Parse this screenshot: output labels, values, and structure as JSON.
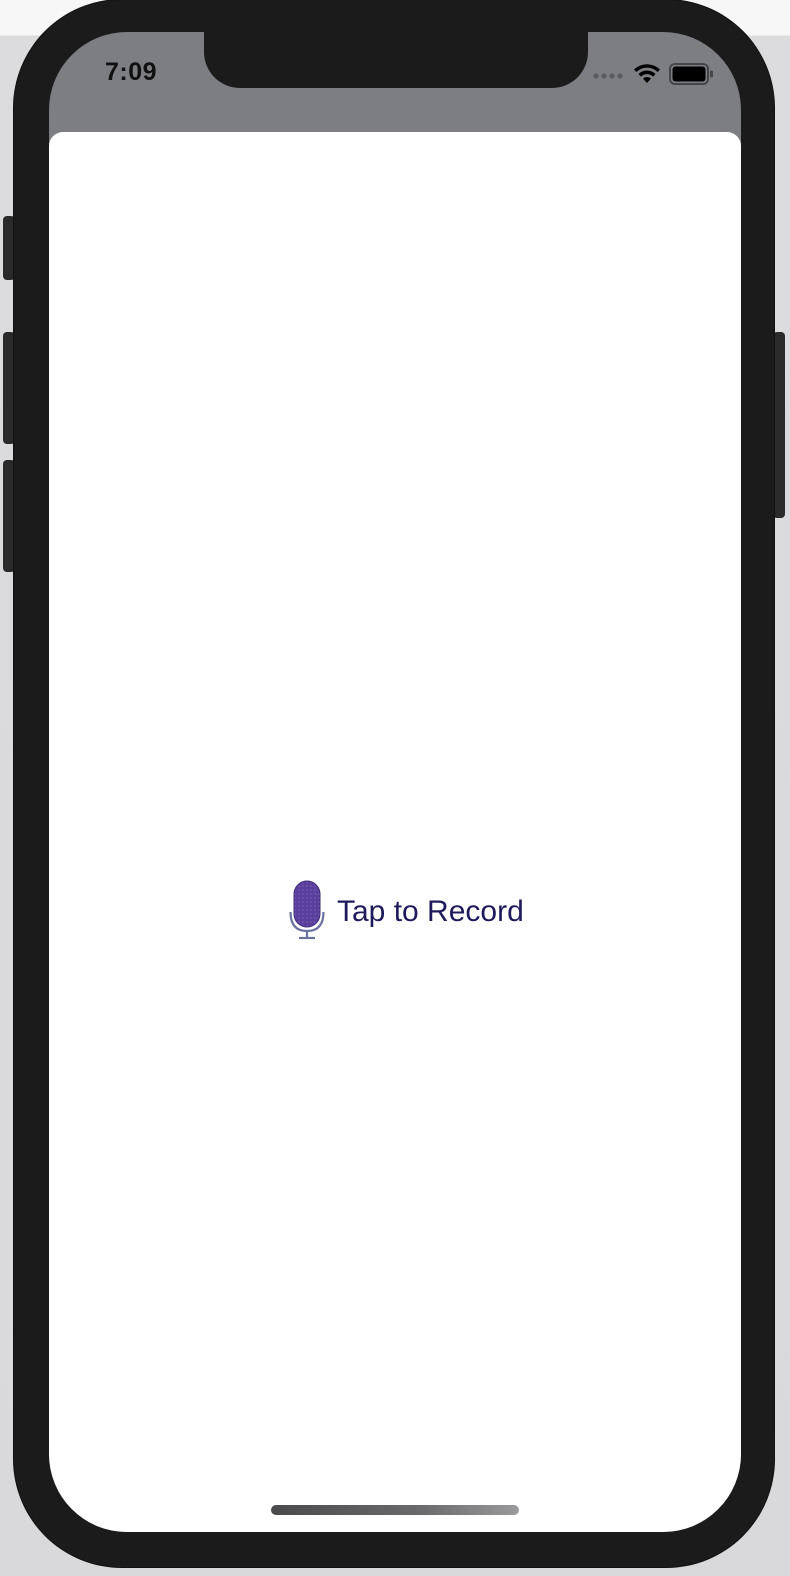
{
  "status_bar": {
    "time": "7:09",
    "icons": [
      "signal-dots-icon",
      "wifi-icon",
      "battery-icon"
    ]
  },
  "main": {
    "record_button": {
      "icon": "microphone-icon",
      "label": "Tap to Record"
    }
  },
  "colors": {
    "accent_text": "#1e1a5c",
    "mic_fill": "#5b3f9c",
    "status_bar_bg": "#7d7e82",
    "device_frame": "#1b1b1c",
    "sheet_bg": "#ffffff"
  }
}
